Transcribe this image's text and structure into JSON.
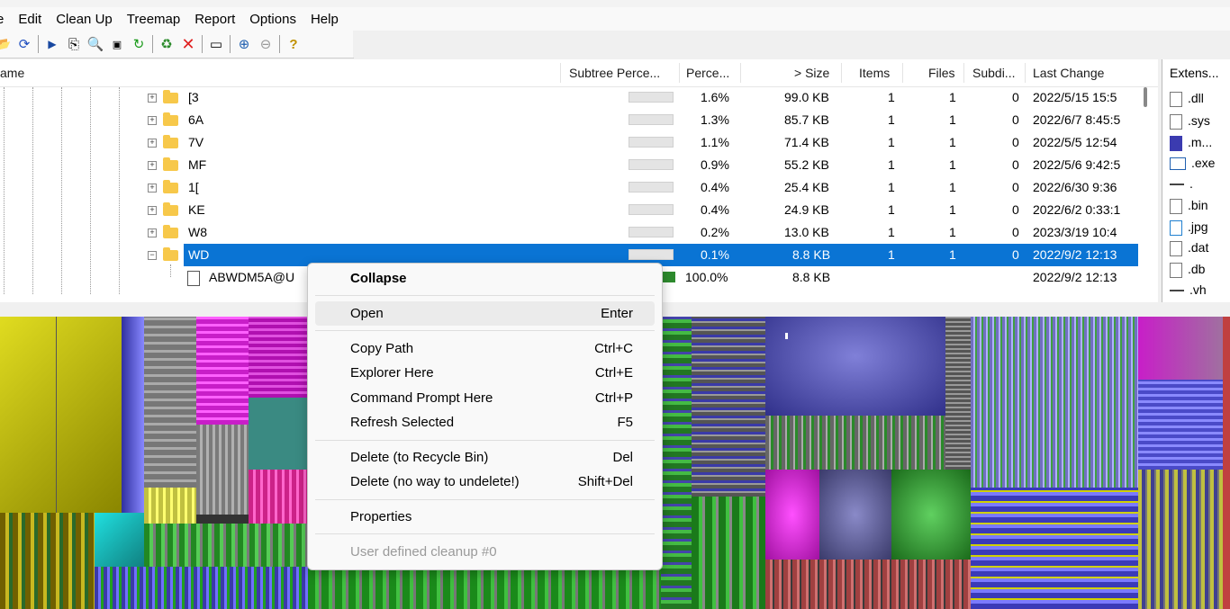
{
  "menu": [
    "e",
    "Edit",
    "Clean Up",
    "Treemap",
    "Report",
    "Options",
    "Help"
  ],
  "columns": {
    "name": "ame",
    "subtree": "Subtree Perce...",
    "perc": "Perce...",
    "size": "> Size",
    "items": "Items",
    "files": "Files",
    "subdirs": "Subdi...",
    "last": "Last Change"
  },
  "rows": [
    {
      "name": "[3",
      "perc": "1.6%",
      "size": "99.0 KB",
      "items": "1",
      "files": "1",
      "subdirs": "0",
      "last": "2022/5/15  15:5"
    },
    {
      "name": "6A",
      "perc": "1.3%",
      "size": "85.7 KB",
      "items": "1",
      "files": "1",
      "subdirs": "0",
      "last": "2022/6/7  8:45:5"
    },
    {
      "name": "7V",
      "perc": "1.1%",
      "size": "71.4 KB",
      "items": "1",
      "files": "1",
      "subdirs": "0",
      "last": "2022/5/5  12:54"
    },
    {
      "name": "MF",
      "perc": "0.9%",
      "size": "55.2 KB",
      "items": "1",
      "files": "1",
      "subdirs": "0",
      "last": "2022/5/6  9:42:5"
    },
    {
      "name": "1[",
      "perc": "0.4%",
      "size": "25.4 KB",
      "items": "1",
      "files": "1",
      "subdirs": "0",
      "last": "2022/6/30  9:36"
    },
    {
      "name": "KE",
      "perc": "0.4%",
      "size": "24.9 KB",
      "items": "1",
      "files": "1",
      "subdirs": "0",
      "last": "2022/6/2  0:33:1"
    },
    {
      "name": "W8",
      "perc": "0.2%",
      "size": "13.0 KB",
      "items": "1",
      "files": "1",
      "subdirs": "0",
      "last": "2023/3/19  10:4"
    },
    {
      "name": "WD",
      "perc": "0.1%",
      "size": "8.8 KB",
      "items": "1",
      "files": "1",
      "subdirs": "0",
      "last": "2022/9/2  12:13"
    },
    {
      "name": "ABWDM5A@U",
      "perc": "100.0%",
      "size": "8.8 KB",
      "items": "",
      "files": "",
      "subdirs": "",
      "last": "2022/9/2  12:13"
    }
  ],
  "extensions": {
    "header": "Extens...",
    "items": [
      ".dll",
      ".sys",
      ".m...",
      ".exe",
      ".",
      ".bin",
      ".jpg",
      ".dat",
      ".db",
      ".vh"
    ]
  },
  "context_menu": {
    "collapse": "Collapse",
    "open": "Open",
    "open_sc": "Enter",
    "copy": "Copy Path",
    "copy_sc": "Ctrl+C",
    "explorer": "Explorer Here",
    "explorer_sc": "Ctrl+E",
    "cmd": "Command Prompt Here",
    "cmd_sc": "Ctrl+P",
    "refresh": "Refresh Selected",
    "refresh_sc": "F5",
    "del_bin": "Delete (to Recycle Bin)",
    "del_bin_sc": "Del",
    "del_perm": "Delete (no way to undelete!)",
    "del_perm_sc": "Shift+Del",
    "props": "Properties",
    "user": "User defined cleanup #0"
  },
  "colors": {
    "selection": "#0a74d4",
    "folder": "#f7c84a",
    "treemap_yellow": "#b8b400",
    "treemap_magenta": "#c81ec8",
    "treemap_green": "#2a9a2a",
    "treemap_blue": "#4848a8"
  }
}
